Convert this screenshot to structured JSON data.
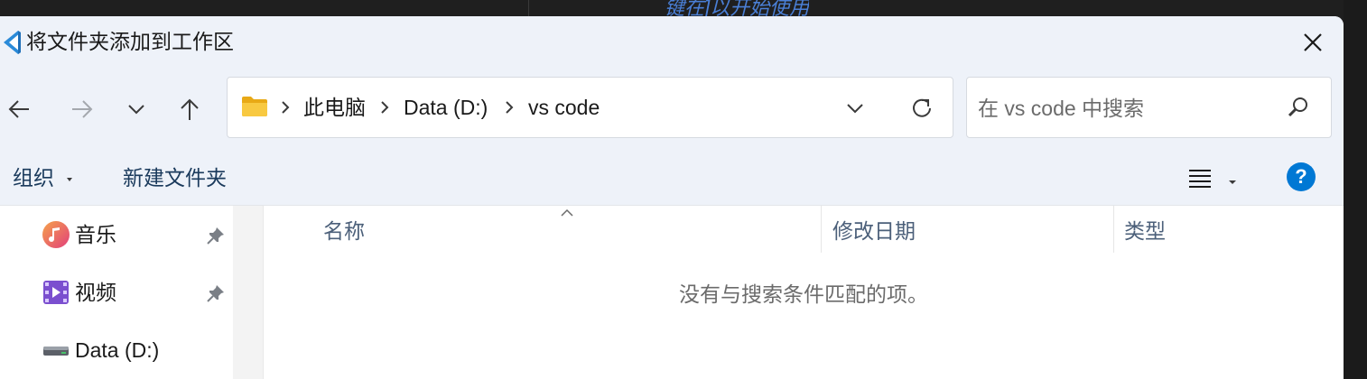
{
  "background": {
    "hint_text": "键在]以开始使用"
  },
  "dialog": {
    "title": "将文件夹添加到工作区",
    "close_label": "✕"
  },
  "address_bar": {
    "breadcrumbs": [
      "此电脑",
      "Data (D:)",
      "vs code"
    ]
  },
  "search": {
    "placeholder": "在 vs code 中搜索"
  },
  "command_bar": {
    "organize_label": "组织",
    "new_folder_label": "新建文件夹",
    "help_label": "?"
  },
  "nav_pane": {
    "items": [
      {
        "label": "音乐",
        "icon": "music-icon",
        "pinned": true
      },
      {
        "label": "视频",
        "icon": "video-icon",
        "pinned": true
      },
      {
        "label": "Data (D:)",
        "icon": "drive-icon",
        "pinned": false
      }
    ]
  },
  "file_list": {
    "columns": [
      "名称",
      "修改日期",
      "类型"
    ],
    "empty_message": "没有与搜索条件匹配的项。"
  },
  "colors": {
    "accent": "#0067c0",
    "folder": "#f8c941",
    "chrome_bg": "#eef2f9",
    "help": "#0078d4"
  }
}
